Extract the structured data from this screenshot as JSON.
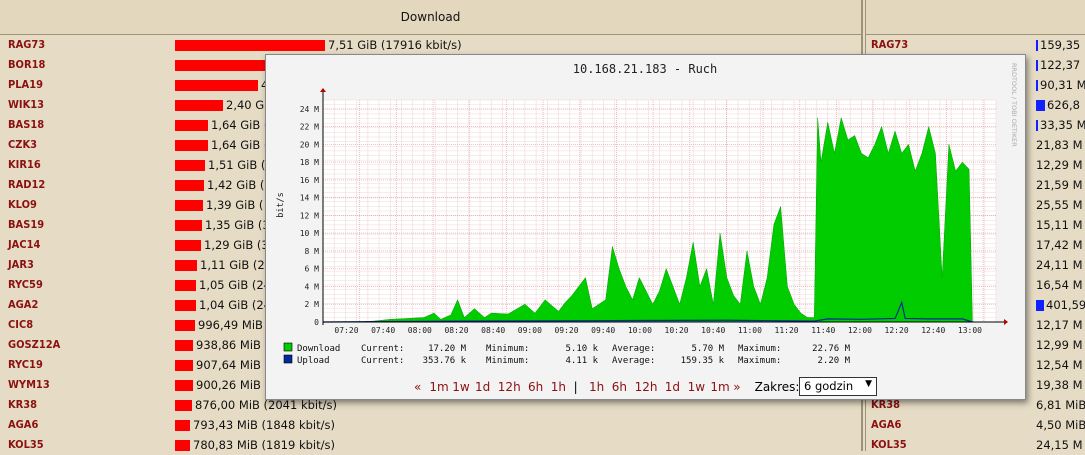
{
  "download_header": "Download",
  "download_rows": [
    {
      "name": "RAG73",
      "text": "7,51 GiB (17916 kbit/s)",
      "fraction": 1.0
    },
    {
      "name": "BOR18",
      "text": "",
      "fraction": 0.62
    },
    {
      "name": "PLA19",
      "text": "4",
      "fraction": 0.55
    },
    {
      "name": "WIK13",
      "text": "2,40 G",
      "fraction": 0.32
    },
    {
      "name": "BAS18",
      "text": "1,64 GiB (",
      "fraction": 0.218
    },
    {
      "name": "CZK3",
      "text": "1,64 GiB (",
      "fraction": 0.218
    },
    {
      "name": "KIR16",
      "text": "1,51 GiB (",
      "fraction": 0.2
    },
    {
      "name": "RAD12",
      "text": "1,42 GiB (",
      "fraction": 0.19
    },
    {
      "name": "KLO9",
      "text": "1,39 GiB (",
      "fraction": 0.185
    },
    {
      "name": "BAS19",
      "text": "1,35 GiB (3",
      "fraction": 0.18
    },
    {
      "name": "JAC14",
      "text": "1,29 GiB (3",
      "fraction": 0.172
    },
    {
      "name": "JAR3",
      "text": "1,11 GiB (26",
      "fraction": 0.148
    },
    {
      "name": "RYC59",
      "text": "1,05 GiB (24",
      "fraction": 0.14
    },
    {
      "name": "AGA2",
      "text": "1,04 GiB (24",
      "fraction": 0.138
    },
    {
      "name": "CIC8",
      "text": "996,49 MiB",
      "fraction": 0.13
    },
    {
      "name": "GOSZ12A",
      "text": "938,86 MiB",
      "fraction": 0.122
    },
    {
      "name": "RYC19",
      "text": "907,64 MiB",
      "fraction": 0.118
    },
    {
      "name": "WYM13",
      "text": "900,26 MiB",
      "fraction": 0.117
    },
    {
      "name": "KR38",
      "text": "876,00 MiB (2041 kbit/s)",
      "fraction": 0.114
    },
    {
      "name": "AGA6",
      "text": "793,43 MiB (1848 kbit/s)",
      "fraction": 0.103
    },
    {
      "name": "KOL35",
      "text": "780,83 MiB (1819 kbit/s)",
      "fraction": 0.101
    }
  ],
  "upload_rows": [
    {
      "name": "RAG73",
      "text": "159,35",
      "bar": true,
      "fraction": 0.1
    },
    {
      "name": "",
      "text": "122,37",
      "bar": true,
      "fraction": 0.08
    },
    {
      "name": "",
      "text": "90,31 M",
      "bar": true,
      "fraction": 0.06
    },
    {
      "name": "",
      "text": "626,8",
      "bar": true,
      "fraction": 0.7
    },
    {
      "name": "",
      "text": "33,35 M",
      "bar": true,
      "fraction": 0.04
    },
    {
      "name": "",
      "text": "21,83 M",
      "bar": false,
      "fraction": 0
    },
    {
      "name": "",
      "text": "12,29 M",
      "bar": false,
      "fraction": 0
    },
    {
      "name": "",
      "text": "21,59 M",
      "bar": false,
      "fraction": 0
    },
    {
      "name": "",
      "text": "25,55 M",
      "bar": false,
      "fraction": 0
    },
    {
      "name": "",
      "text": "15,11 M",
      "bar": false,
      "fraction": 0
    },
    {
      "name": "",
      "text": "17,42 M",
      "bar": false,
      "fraction": 0
    },
    {
      "name": "",
      "text": "24,11 M",
      "bar": false,
      "fraction": 0
    },
    {
      "name": "",
      "text": "16,54 M",
      "bar": false,
      "fraction": 0
    },
    {
      "name": "",
      "text": "401,59",
      "bar": true,
      "fraction": 0.6
    },
    {
      "name": "",
      "text": "12,17 M",
      "bar": false,
      "fraction": 0
    },
    {
      "name": "",
      "text": "12,99 M",
      "bar": false,
      "fraction": 0
    },
    {
      "name": "",
      "text": "12,54 M",
      "bar": false,
      "fraction": 0
    },
    {
      "name": "",
      "text": "19,38 M",
      "bar": false,
      "fraction": 0
    },
    {
      "name": "KR38",
      "text": "6,81 MiB",
      "bar": false,
      "fraction": 0
    },
    {
      "name": "AGA6",
      "text": "4,50 MiB",
      "bar": false,
      "fraction": 0
    },
    {
      "name": "KOL35",
      "text": "24,15 M",
      "bar": false,
      "fraction": 0
    }
  ],
  "popup": {
    "watermark": "RRDTOOL / TOBI OETIKER",
    "legend": [
      {
        "name": "Download",
        "color": "#00cc00",
        "current": "17.20 M",
        "minimum": "5.10 k",
        "average": "5.70 M",
        "maximum": "22.76 M"
      },
      {
        "name": "Upload",
        "color": "#002a97",
        "current": "353.76 k",
        "minimum": "4.11 k",
        "average": "159.35 k",
        "maximum": "2.20 M"
      }
    ],
    "legend_labels": {
      "current": "Current:",
      "minimum": "Minimum:",
      "average": "Average:",
      "maximum": "Maximum:"
    },
    "nav": {
      "open": "«",
      "back": [
        "1m",
        "1w",
        "1d",
        "12h",
        "6h",
        "1h"
      ],
      "sep": "|",
      "fwd": [
        "1h",
        "6h",
        "12h",
        "1d",
        "1w",
        "1m"
      ],
      "close": "»",
      "range_label": "Zakres:",
      "range_value": "6 godzin"
    }
  },
  "chart_data": {
    "type": "area",
    "title": "10.168.21.183 - Ruch",
    "ylabel": "bit/s",
    "ylim": [
      0,
      25000000
    ],
    "yticks": [
      "0",
      "2 M",
      "4 M",
      "6 M",
      "8 M",
      "10 M",
      "12 M",
      "14 M",
      "16 M",
      "18 M",
      "20 M",
      "22 M",
      "24 M"
    ],
    "xticks": [
      "07:20",
      "07:40",
      "08:00",
      "08:20",
      "08:40",
      "09:00",
      "09:20",
      "09:40",
      "10:00",
      "10:20",
      "10:40",
      "11:00",
      "11:20",
      "11:40",
      "12:00",
      "12:20",
      "12:40",
      "13:00"
    ],
    "grid": true,
    "series": [
      {
        "name": "Download",
        "color": "#00cc00",
        "points": [
          [
            0,
            0
          ],
          [
            0.05,
            0
          ],
          [
            0.1,
            0
          ],
          [
            0.15,
            100000
          ],
          [
            0.2,
            300000
          ],
          [
            0.25,
            400000
          ],
          [
            0.3,
            500000
          ],
          [
            0.33,
            1000000
          ],
          [
            0.35,
            300000
          ],
          [
            0.38,
            800000
          ],
          [
            0.4,
            2500000
          ],
          [
            0.42,
            500000
          ],
          [
            0.45,
            1500000
          ],
          [
            0.48,
            500000
          ],
          [
            0.5,
            1000000
          ],
          [
            0.55,
            900000
          ],
          [
            0.6,
            2000000
          ],
          [
            0.63,
            1000000
          ],
          [
            0.66,
            2500000
          ],
          [
            0.7,
            1200000
          ],
          [
            0.72,
            2200000
          ],
          [
            0.74,
            3000000
          ],
          [
            0.76,
            4000000
          ],
          [
            0.78,
            5000000
          ],
          [
            0.8,
            1500000
          ],
          [
            0.82,
            2000000
          ],
          [
            0.84,
            2500000
          ],
          [
            0.86,
            8500000
          ],
          [
            0.88,
            6000000
          ],
          [
            0.9,
            4000000
          ],
          [
            0.92,
            2500000
          ],
          [
            0.94,
            5000000
          ],
          [
            0.96,
            3500000
          ],
          [
            0.98,
            2000000
          ],
          [
            1.0,
            3500000
          ],
          [
            1.02,
            6000000
          ],
          [
            1.04,
            4000000
          ],
          [
            1.06,
            2000000
          ],
          [
            1.08,
            5000000
          ],
          [
            1.1,
            9000000
          ],
          [
            1.12,
            4000000
          ],
          [
            1.14,
            6000000
          ],
          [
            1.16,
            2000000
          ],
          [
            1.18,
            10000000
          ],
          [
            1.2,
            5000000
          ],
          [
            1.22,
            3000000
          ],
          [
            1.24,
            2000000
          ],
          [
            1.26,
            8000000
          ],
          [
            1.28,
            4000000
          ],
          [
            1.3,
            2000000
          ],
          [
            1.32,
            5000000
          ],
          [
            1.34,
            11000000
          ],
          [
            1.36,
            13000000
          ],
          [
            1.38,
            4000000
          ],
          [
            1.4,
            2000000
          ],
          [
            1.42,
            1000000
          ],
          [
            1.44,
            500000
          ],
          [
            1.46,
            500000
          ],
          [
            1.47,
            23000000
          ],
          [
            1.48,
            18000000
          ],
          [
            1.5,
            22500000
          ],
          [
            1.52,
            19000000
          ],
          [
            1.54,
            23000000
          ],
          [
            1.56,
            20500000
          ],
          [
            1.58,
            21000000
          ],
          [
            1.6,
            19000000
          ],
          [
            1.62,
            18500000
          ],
          [
            1.64,
            20000000
          ],
          [
            1.66,
            22000000
          ],
          [
            1.68,
            19000000
          ],
          [
            1.7,
            21500000
          ],
          [
            1.72,
            19000000
          ],
          [
            1.74,
            20000000
          ],
          [
            1.76,
            17000000
          ],
          [
            1.78,
            19000000
          ],
          [
            1.8,
            22000000
          ],
          [
            1.82,
            19000000
          ],
          [
            1.84,
            5000000
          ],
          [
            1.86,
            20000000
          ],
          [
            1.88,
            17000000
          ],
          [
            1.9,
            18000000
          ],
          [
            1.92,
            17200000
          ],
          [
            1.93,
            0
          ]
        ]
      },
      {
        "name": "Upload",
        "color": "#002a97",
        "points": [
          [
            0,
            0
          ],
          [
            0.4,
            100000
          ],
          [
            0.8,
            150000
          ],
          [
            1.2,
            200000
          ],
          [
            1.46,
            100000
          ],
          [
            1.5,
            350000
          ],
          [
            1.6,
            300000
          ],
          [
            1.7,
            400000
          ],
          [
            1.72,
            2200000
          ],
          [
            1.73,
            400000
          ],
          [
            1.8,
            350000
          ],
          [
            1.9,
            350000
          ],
          [
            1.93,
            0
          ]
        ]
      }
    ]
  }
}
